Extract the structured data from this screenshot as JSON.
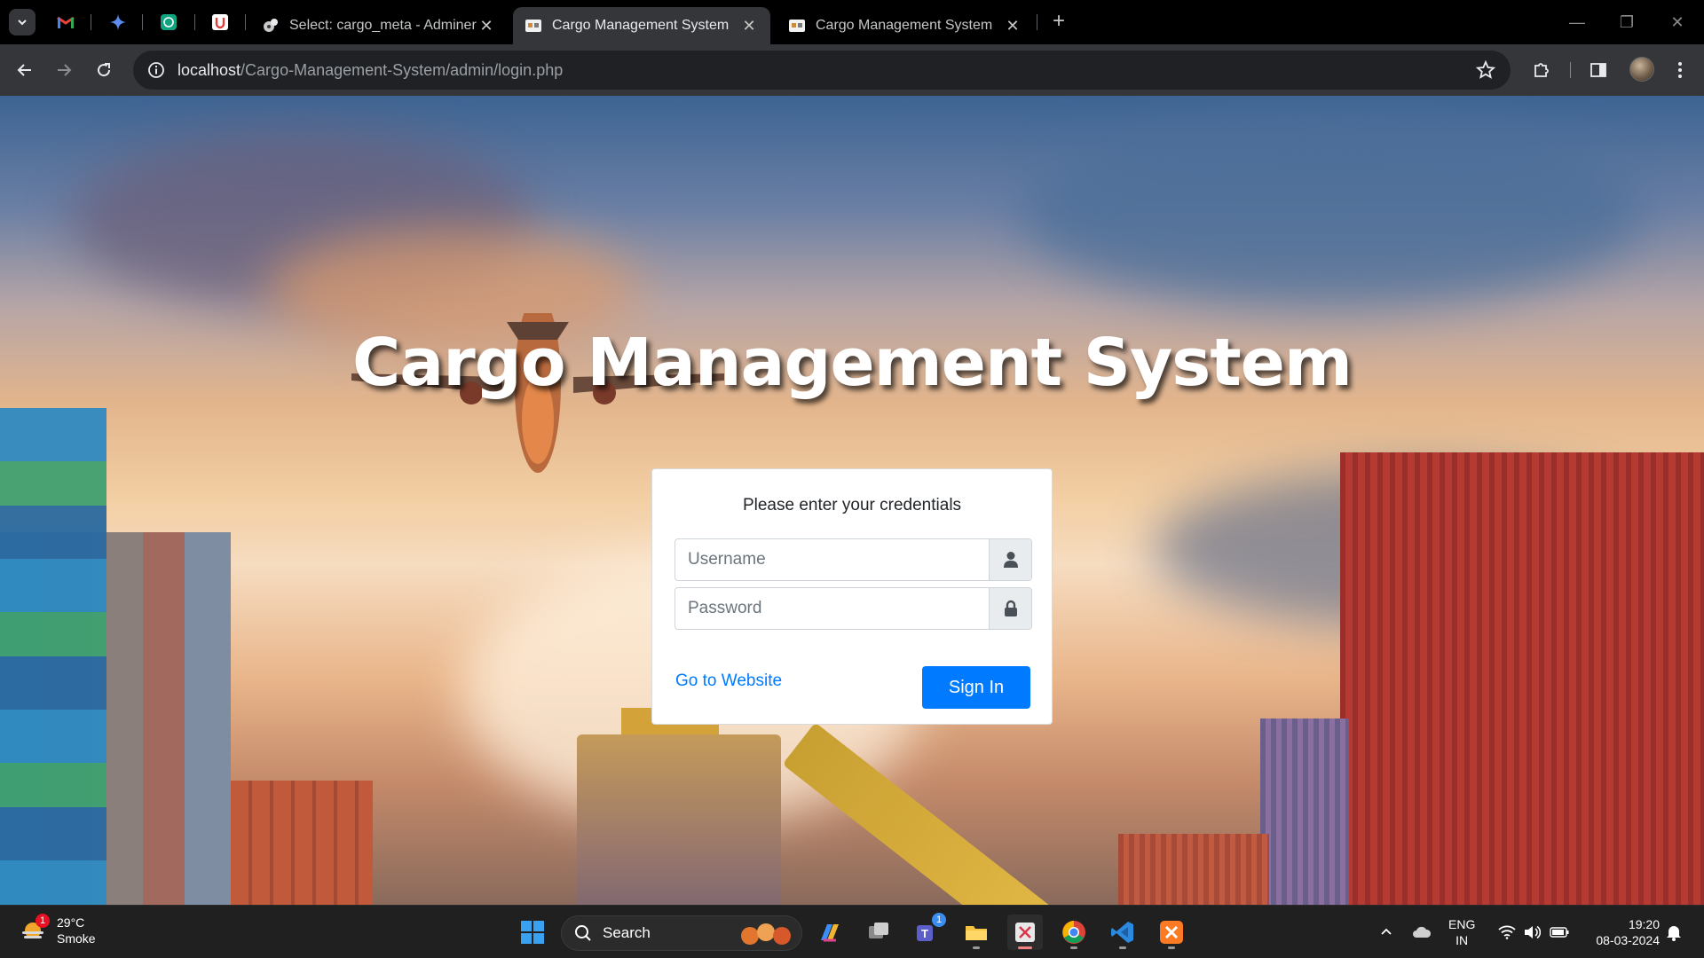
{
  "browser": {
    "tabs": [
      {
        "title": "Select: cargo_meta - Adminer",
        "active": false
      },
      {
        "title": "Cargo Management System",
        "active": true
      },
      {
        "title": "Cargo Management System",
        "active": false
      }
    ],
    "url": {
      "host": "localhost",
      "path": "/Cargo-Management-System/admin/login.php"
    }
  },
  "page": {
    "heading": "Cargo Management System",
    "login": {
      "message": "Please enter your credentials",
      "username_placeholder": "Username",
      "password_placeholder": "Password",
      "website_link": "Go to Website",
      "signin_label": "Sign In"
    }
  },
  "taskbar": {
    "weather": {
      "temp": "29°C",
      "condition": "Smoke",
      "badge": "1"
    },
    "search_label": "Search",
    "teams_badge": "1",
    "language": {
      "line1": "ENG",
      "line2": "IN"
    },
    "clock": {
      "time": "19:20",
      "date": "08-03-2024"
    }
  },
  "colors": {
    "primary": "#007bff",
    "tab_active": "#35363a",
    "tabbar": "#000000",
    "taskbar": "#202020"
  }
}
